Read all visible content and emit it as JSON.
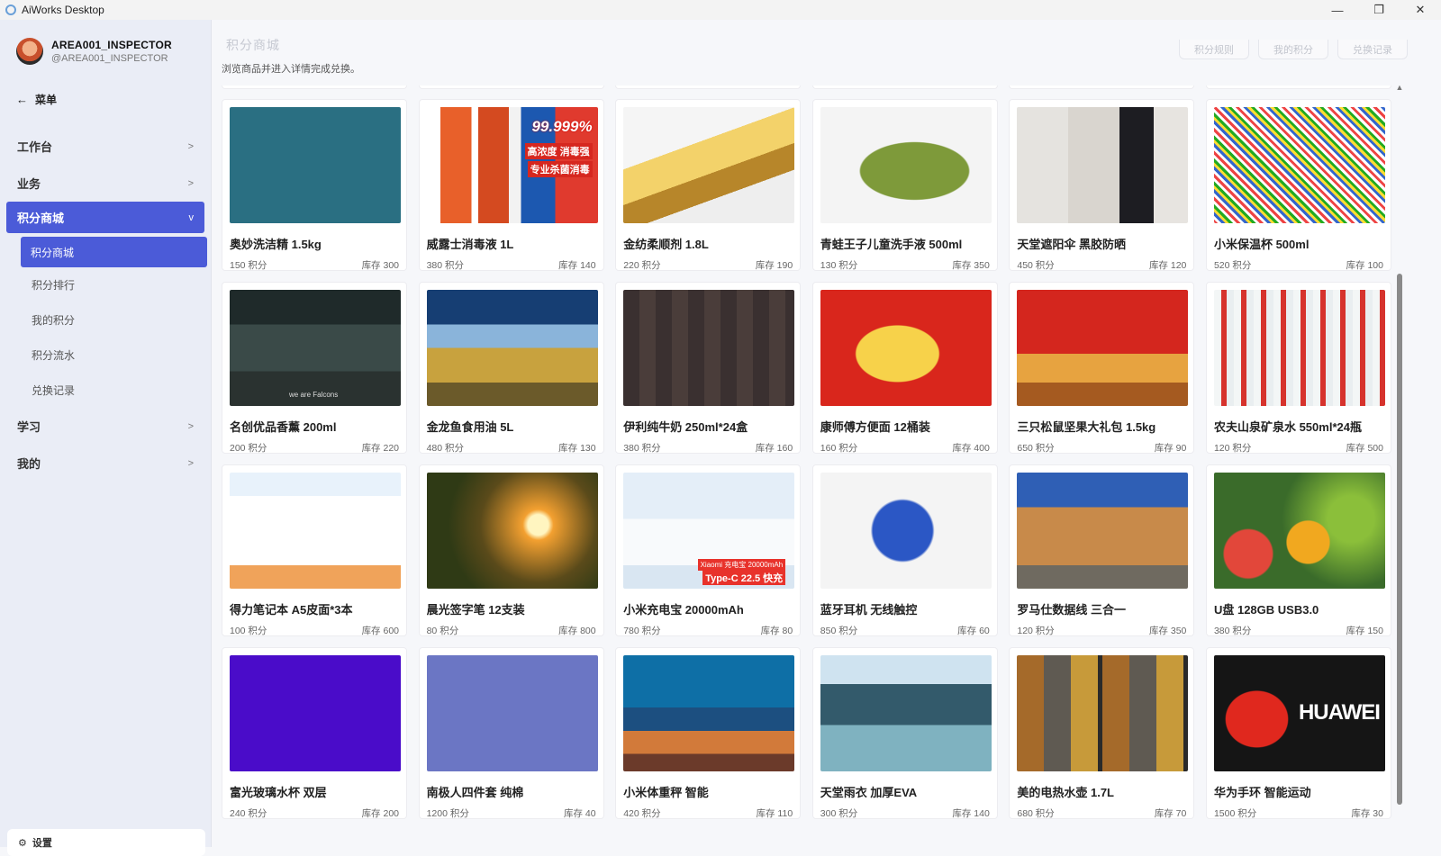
{
  "titlebar": {
    "title": "AiWorks Desktop",
    "minimize": "—",
    "restore": "❐",
    "close": "✕"
  },
  "user": {
    "name": "AREA001_INSPECTOR",
    "handle": "@AREA001_INSPECTOR"
  },
  "menu": {
    "back_label": "菜单",
    "back_icon": "←"
  },
  "nav": {
    "items": [
      {
        "label": "工作台",
        "chev": ">"
      },
      {
        "label": "业务",
        "chev": ">"
      },
      {
        "label": "积分商城",
        "chev": "v"
      },
      {
        "label": "学习",
        "chev": ">"
      },
      {
        "label": "我的",
        "chev": ">"
      }
    ],
    "sub": [
      {
        "label": "积分商城"
      },
      {
        "label": "积分排行"
      },
      {
        "label": "我的积分"
      },
      {
        "label": "积分流水"
      },
      {
        "label": "兑换记录"
      }
    ],
    "settings": "设置",
    "settings_icon": "⚙"
  },
  "header": {
    "breadcrumb": "积分商城",
    "description": "浏览商品并进入详情完成兑换。",
    "tabs": [
      "积分规则",
      "我的积分",
      "兑换记录"
    ]
  },
  "colors": {
    "accent": "#4b5bd8"
  },
  "products": [
    {
      "name": "奥妙洗洁精 1.5kg",
      "points": "150 积分",
      "stock": "库存 300",
      "img": "teal-swatch"
    },
    {
      "name": "威露士消毒液 1L",
      "points": "380 积分",
      "stock": "库存 140",
      "img": "disinfectant",
      "img_text": [
        "99.999%",
        "高浓度 消毒强",
        "专业杀菌消毒"
      ]
    },
    {
      "name": "金纺柔顺剂 1.8L",
      "points": "220 积分",
      "stock": "库存 190",
      "img": "gold-bar"
    },
    {
      "name": "青蛙王子儿童洗手液 500ml",
      "points": "130 积分",
      "stock": "库存 350",
      "img": "frog"
    },
    {
      "name": "天堂遮阳伞 黑胶防晒",
      "points": "450 积分",
      "stock": "库存 120",
      "img": "office-woman"
    },
    {
      "name": "小米保温杯 500ml",
      "points": "520 积分",
      "stock": "库存 100",
      "img": "pattern"
    },
    {
      "name": "名创优品香薰 200ml",
      "points": "200 积分",
      "stock": "库存 220",
      "img": "team-stage",
      "img_text": [
        "we are Falcons"
      ]
    },
    {
      "name": "金龙鱼食用油 5L",
      "points": "480 积分",
      "stock": "库存 130",
      "img": "golden-dragon"
    },
    {
      "name": "伊利纯牛奶 250ml*24盒",
      "points": "380 积分",
      "stock": "库存 160",
      "img": "calligraphy"
    },
    {
      "name": "康师傅方便面 12桶装",
      "points": "160 积分",
      "stock": "库存 400",
      "img": "red-gift"
    },
    {
      "name": "三只松鼠坚果大礼包 1.5kg",
      "points": "650 积分",
      "stock": "库存 90",
      "img": "nut-gift"
    },
    {
      "name": "农夫山泉矿泉水 550ml*24瓶",
      "points": "120 积分",
      "stock": "库存 500",
      "img": "water-bottles"
    },
    {
      "name": "得力笔记本 A5皮面*3本",
      "points": "100 积分",
      "stock": "库存 600",
      "img": "chart-diagram"
    },
    {
      "name": "晨光签字笔 12支装",
      "points": "80 积分",
      "stock": "库存 800",
      "img": "sunset-forest"
    },
    {
      "name": "小米充电宝 20000mAh",
      "points": "780 积分",
      "stock": "库存 80",
      "img": "power-bank",
      "img_text": [
        "Xiaomi 充电宝 20000mAh",
        "Type-C 22.5 快充"
      ]
    },
    {
      "name": "蓝牙耳机 无线触控",
      "points": "850 积分",
      "stock": "库存 60",
      "img": "bluetooth"
    },
    {
      "name": "罗马仕数据线 三合一",
      "points": "120 积分",
      "stock": "库存 350",
      "img": "colosseum"
    },
    {
      "name": "U盘 128GB USB3.0",
      "points": "380 积分",
      "stock": "库存 150",
      "img": "fruits"
    },
    {
      "name": "富光玻璃水杯 双层",
      "points": "240 积分",
      "stock": "库存 200",
      "img": "purple-swatch"
    },
    {
      "name": "南极人四件套 纯棉",
      "points": "1200 积分",
      "stock": "库存 40",
      "img": "blue-swatch"
    },
    {
      "name": "小米体重秤 智能",
      "points": "420 积分",
      "stock": "库存 110",
      "img": "coral-reef"
    },
    {
      "name": "天堂雨衣 加厚EVA",
      "points": "300 积分",
      "stock": "库存 140",
      "img": "factory-line"
    },
    {
      "name": "美的电热水壶 1.7L",
      "points": "680 积分",
      "stock": "库存 70",
      "img": "photo-collage"
    },
    {
      "name": "华为手环 智能运动",
      "points": "1500 积分",
      "stock": "库存 30",
      "img": "huawei-logo",
      "img_text": [
        "HUAWEI"
      ]
    }
  ]
}
